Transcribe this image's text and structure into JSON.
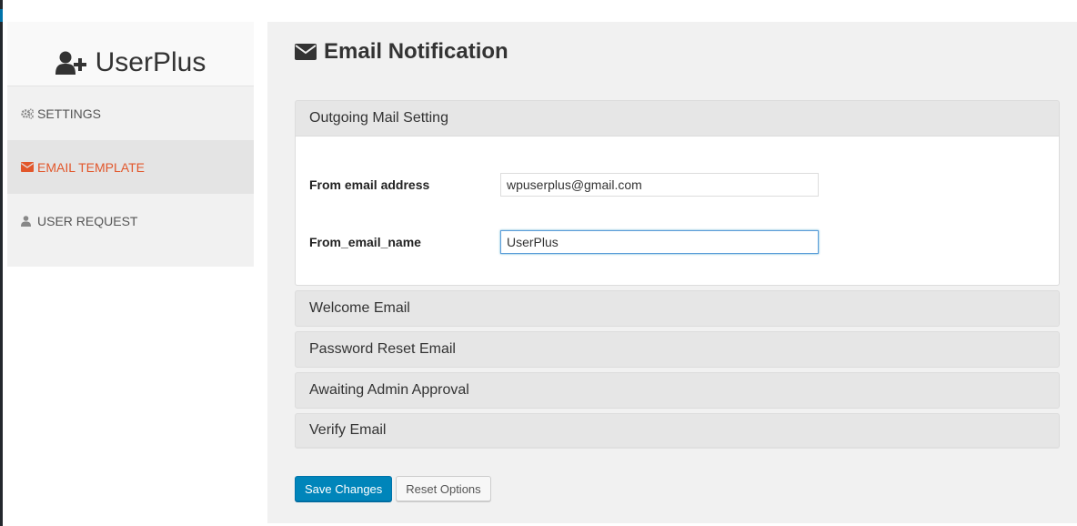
{
  "app": {
    "brand_name": "UserPlus",
    "brand_icon": "user-plus-icon"
  },
  "sidebar": {
    "items": [
      {
        "label": "SETTINGS",
        "icon": "gears-icon",
        "active": false
      },
      {
        "label": "EMAIL TEMPLATE",
        "icon": "envelope-icon",
        "active": true
      },
      {
        "label": "USER REQUEST",
        "icon": "user-icon",
        "active": false
      }
    ]
  },
  "main": {
    "title": "Email Notification",
    "title_icon": "envelope-icon",
    "panels": [
      {
        "title": "Outgoing Mail Setting",
        "expanded": true,
        "fields": [
          {
            "label": "From email address",
            "value": "wpuserplus@gmail.com"
          },
          {
            "label": "From_email_name",
            "value": "UserPlus"
          }
        ]
      },
      {
        "title": "Welcome Email",
        "expanded": false
      },
      {
        "title": "Password Reset Email",
        "expanded": false
      },
      {
        "title": "Awaiting Admin Approval",
        "expanded": false
      },
      {
        "title": "Verify Email",
        "expanded": false
      }
    ],
    "actions": {
      "save_label": "Save Changes",
      "reset_label": "Reset Options"
    }
  },
  "colors": {
    "accent_active": "#e2572b",
    "primary_button": "#0085ba",
    "panel_header": "#e6e6e6",
    "background": "#f1f1f1"
  }
}
